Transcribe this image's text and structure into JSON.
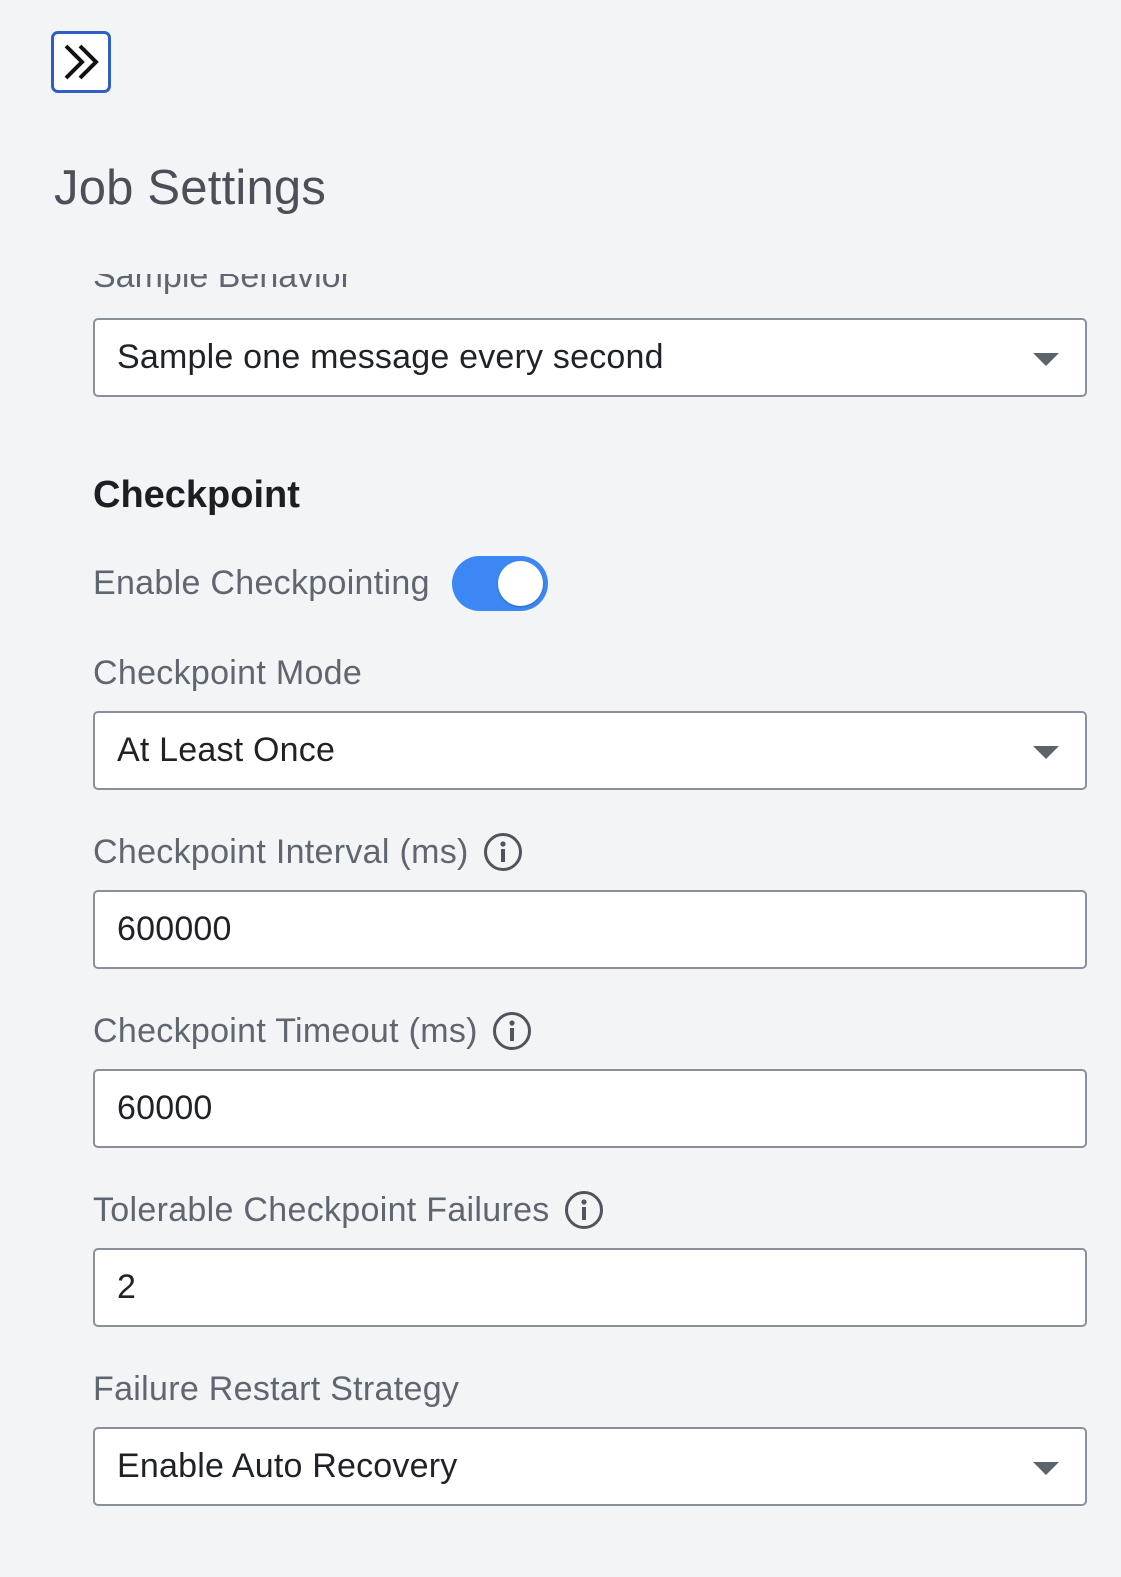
{
  "header": {
    "expand_icon": "double-chevron-right-icon",
    "title": "Job Settings"
  },
  "sample": {
    "label": "Sample Behavior",
    "value": "Sample one message every second"
  },
  "checkpoint": {
    "heading": "Checkpoint",
    "enable": {
      "label": "Enable Checkpointing",
      "on": true
    },
    "mode": {
      "label": "Checkpoint Mode",
      "value": "At Least Once"
    },
    "interval": {
      "label": "Checkpoint Interval (ms)",
      "value": "600000"
    },
    "timeout": {
      "label": "Checkpoint Timeout (ms)",
      "value": "60000"
    },
    "tolerable": {
      "label": "Tolerable Checkpoint Failures",
      "value": "2"
    },
    "restart": {
      "label": "Failure Restart Strategy",
      "value": "Enable Auto Recovery"
    }
  },
  "colors": {
    "accent": "#2f5fc4",
    "toggle_on": "#3d87f5",
    "background": "#f3f4f6"
  }
}
